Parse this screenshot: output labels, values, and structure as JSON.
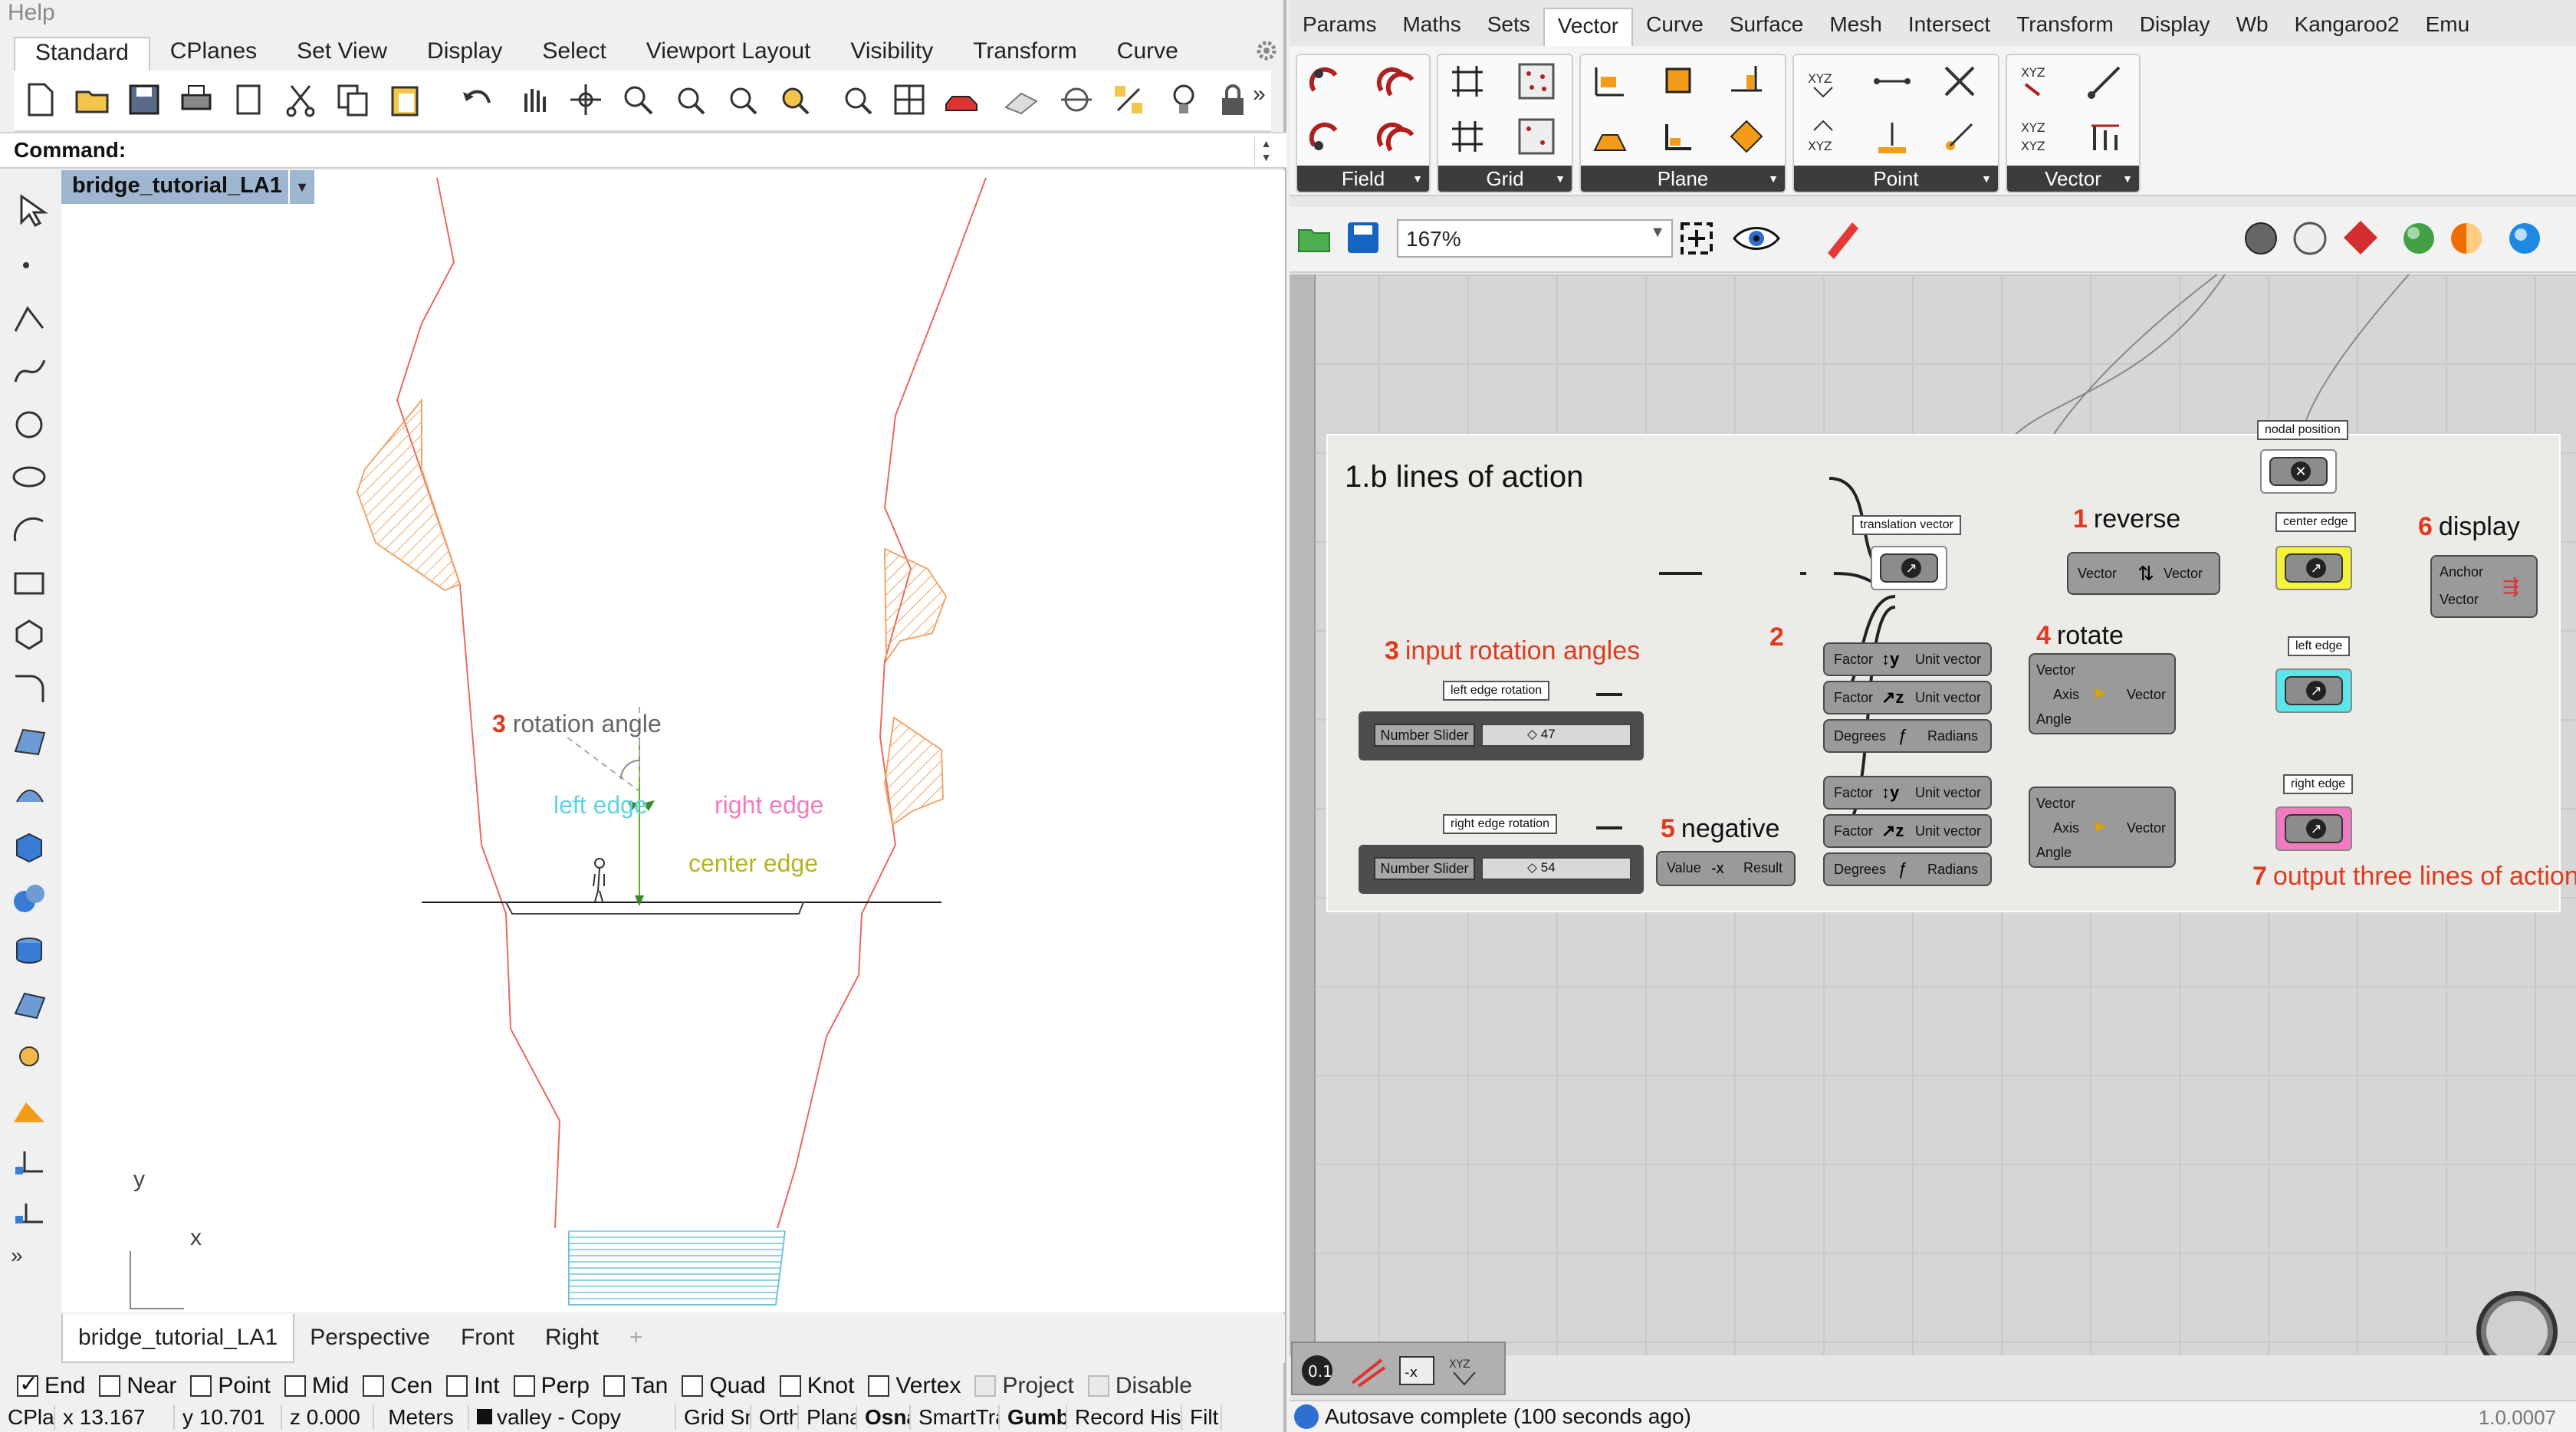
{
  "rhino": {
    "help_menu": "Help",
    "tabs": [
      "Standard",
      "CPlanes",
      "Set View",
      "Display",
      "Select",
      "Viewport Layout",
      "Visibility",
      "Transform",
      "Curve"
    ],
    "tabs_overflow": "»",
    "toolbar_overflow": "»",
    "command_label": "Command:",
    "viewport": {
      "title": "bridge_tutorial_LA1",
      "annotations": {
        "rotation_num": "3",
        "rotation_label": "rotation angle",
        "left_edge": "left edge",
        "right_edge": "right edge",
        "center_edge": "center edge"
      },
      "axis_y": "y",
      "axis_x": "x"
    },
    "lefttools_overflow": "»",
    "viewport_tabs": [
      "bridge_tutorial_LA1",
      "Perspective",
      "Front",
      "Right"
    ],
    "viewport_tab_add": "+",
    "osnaps": [
      {
        "label": "End",
        "checked": true
      },
      {
        "label": "Near",
        "checked": false
      },
      {
        "label": "Point",
        "checked": false
      },
      {
        "label": "Mid",
        "checked": false
      },
      {
        "label": "Cen",
        "checked": false
      },
      {
        "label": "Int",
        "checked": false
      },
      {
        "label": "Perp",
        "checked": false
      },
      {
        "label": "Tan",
        "checked": false
      },
      {
        "label": "Quad",
        "checked": false
      },
      {
        "label": "Knot",
        "checked": false
      },
      {
        "label": "Vertex",
        "checked": false
      },
      {
        "label": "Project",
        "checked": false,
        "dim": true
      },
      {
        "label": "Disable",
        "checked": false,
        "dim": true
      }
    ],
    "status": {
      "cplane": "CPlan",
      "x": "x 13.167",
      "y": "y 10.701",
      "z": "z 0.000",
      "units": "Meters",
      "layer": "valley - Copy",
      "grid_snap": "Grid Sn",
      "ortho": "Orth",
      "planar": "Plana",
      "osnap": "Osna",
      "smarttrack": "SmartTra",
      "gumball": "Gumb",
      "record_history": "Record Hist",
      "filter": "Filt"
    }
  },
  "gh": {
    "menu": [
      "Params",
      "Maths",
      "Sets",
      "Vector",
      "Curve",
      "Surface",
      "Mesh",
      "Intersect",
      "Transform",
      "Display",
      "Wb",
      "Kangaroo2",
      "Emu"
    ],
    "active_menu": "Vector",
    "ribbon_panels": [
      "Field",
      "Grid",
      "Plane",
      "Point",
      "Vector"
    ],
    "zoom": "167%",
    "group_title": "1.b lines of action",
    "annotations": {
      "reverse_num": "1",
      "reverse": "reverse",
      "step2_num": "2",
      "input_num": "3",
      "input": "input rotation angles",
      "rotate_num": "4",
      "rotate": "rotate",
      "negative_num": "5",
      "negative": "negative",
      "display_num": "6",
      "display": "display",
      "output_num": "7",
      "output": "output three lines of action"
    },
    "labels": {
      "nodal_position": "nodal position",
      "translation_vector": "translation vector",
      "center_edge": "center edge",
      "left_edge": "left edge",
      "right_edge": "right edge",
      "left_edge_rotation": "left edge rotation",
      "right_edge_rotation": "right edge rotation"
    },
    "reverse_comp": {
      "in": "Vector",
      "out": "Vector"
    },
    "unit_y": {
      "in": "Factor",
      "out": "Unit vector"
    },
    "unit_z": {
      "in": "Factor",
      "out": "Unit vector"
    },
    "radians": {
      "in": "Degrees",
      "out": "Radians"
    },
    "rotate_comp": {
      "in1": "Vector",
      "in2": "Axis",
      "in3": "Angle",
      "out": "Vector"
    },
    "negative_comp": {
      "in": "Value",
      "out": "Result"
    },
    "display_comp": {
      "in1": "Anchor",
      "in2": "Vector"
    },
    "slider_left": {
      "label": "Number Slider",
      "value": "◇ 47"
    },
    "slider_right": {
      "label": "Number Slider",
      "value": "◇ 54"
    },
    "status_text": "Autosave complete (100 seconds ago)",
    "version": "1.0.0007",
    "colors": {
      "center_edge": "#f5f23c",
      "left_edge": "#5ce6ec",
      "right_edge": "#f07cc0",
      "annotation_red": "#e03a1e"
    }
  }
}
